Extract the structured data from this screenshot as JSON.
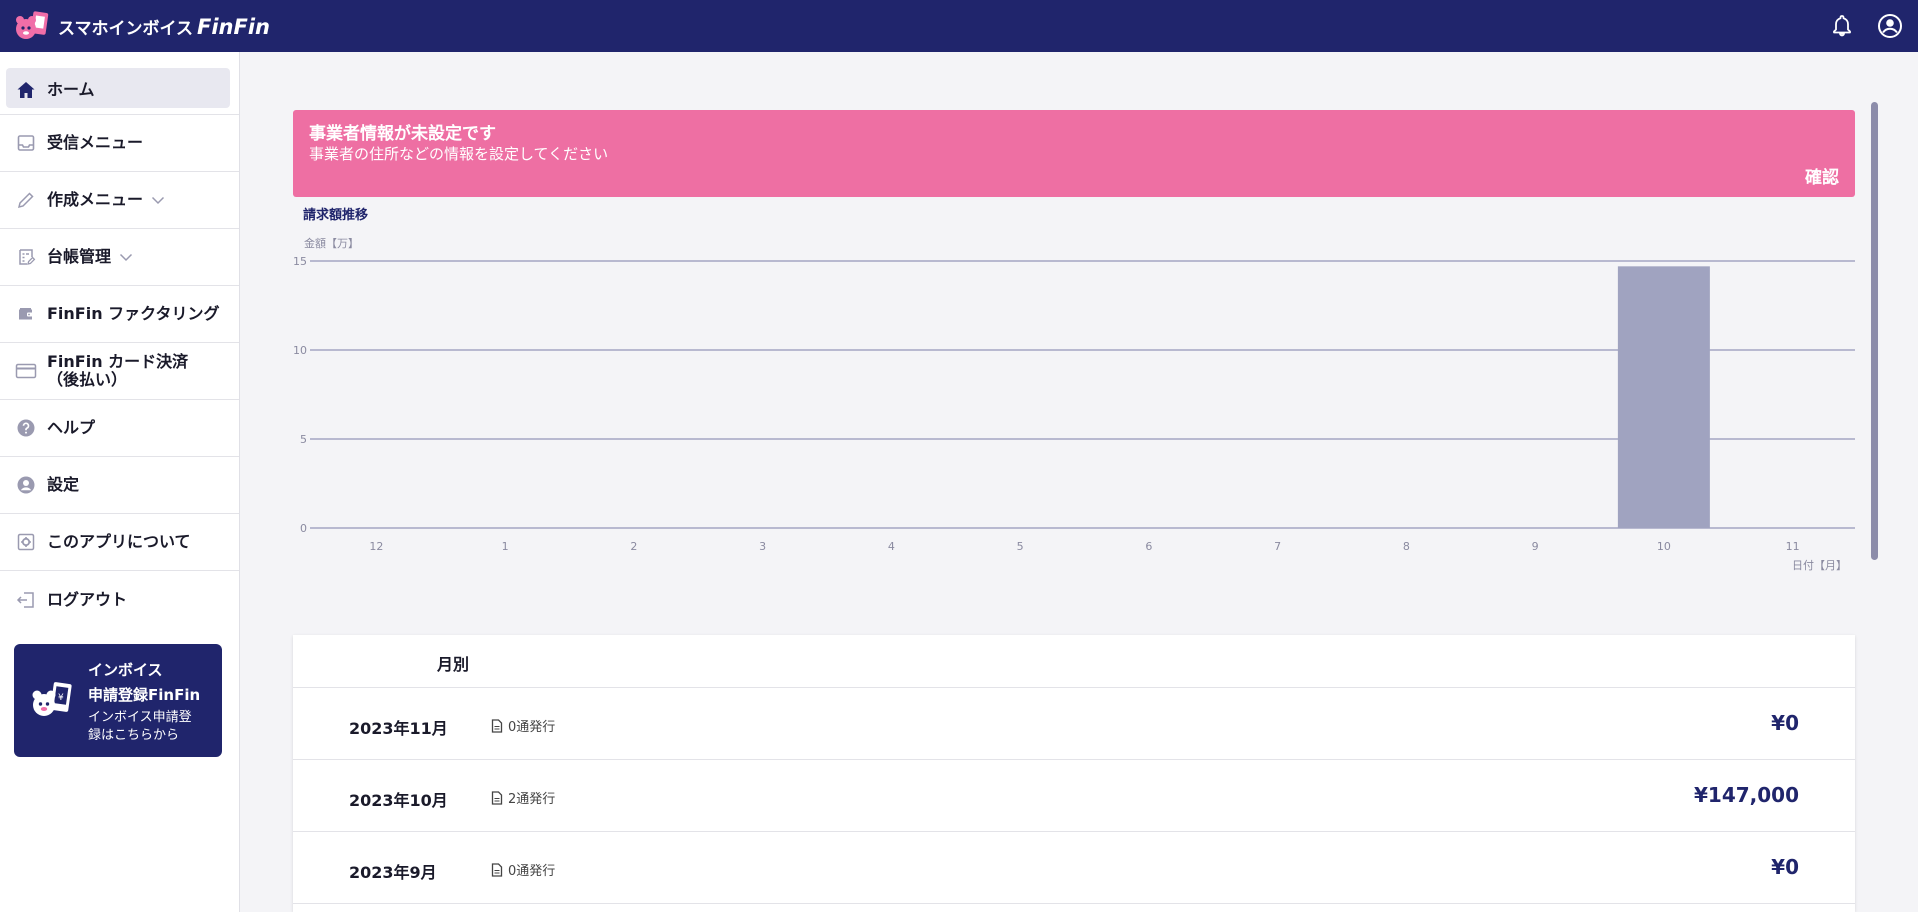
{
  "app": {
    "logo_text": "スマホインボイス",
    "logo_brand": "FinFin"
  },
  "header": {
    "icons": [
      "bell-icon",
      "account-circle-icon"
    ]
  },
  "sidebar": {
    "items": [
      {
        "label": "ホーム",
        "icon": "home-icon"
      },
      {
        "label": "受信メニュー",
        "icon": "inbox-icon"
      },
      {
        "label": "作成メニュー",
        "icon": "pencil-icon"
      },
      {
        "label": "台帳管理",
        "icon": "ledger-icon"
      },
      {
        "label": "FinFin ファクタリング",
        "icon": "wallet-icon"
      },
      {
        "label": "FinFin カード決済",
        "label2": "（後払い）",
        "icon": "credit-card-icon"
      },
      {
        "label": "ヘルプ",
        "icon": "help-icon"
      },
      {
        "label": "設定",
        "icon": "account-icon"
      },
      {
        "label": "このアプリについて",
        "icon": "settings-box-icon"
      },
      {
        "label": "ログアウト",
        "icon": "logout-icon"
      }
    ],
    "banner": {
      "title1": "インボイス",
      "title2": "申請登録FinFin",
      "sub1": "インボイス申請登",
      "sub2": "録はこちらから"
    }
  },
  "alert": {
    "title": "事業者情報が未設定です",
    "text": "事業者の住所などの情報を設定してください",
    "action": "確認"
  },
  "chart_data": {
    "type": "bar",
    "title": "請求額推移",
    "ylabel": "金額【万】",
    "xlabel": "日付【月】",
    "categories": [
      "12",
      "1",
      "2",
      "3",
      "4",
      "5",
      "6",
      "7",
      "8",
      "9",
      "10",
      "11"
    ],
    "values": [
      0,
      0,
      0,
      0,
      0,
      0,
      0,
      0,
      0,
      0,
      14.7,
      0
    ],
    "ylim": [
      0,
      15
    ],
    "yticks": [
      0,
      5,
      10,
      15
    ],
    "grid": true,
    "bar_color": "#a0a3c0"
  },
  "monthly": {
    "header": "月別",
    "rows": [
      {
        "month": "2023年11月",
        "count": "0通発行",
        "amount": "¥0"
      },
      {
        "month": "2023年10月",
        "count": "2通発行",
        "amount": "¥147,000"
      },
      {
        "month": "2023年9月",
        "count": "0通発行",
        "amount": "¥0"
      }
    ]
  }
}
